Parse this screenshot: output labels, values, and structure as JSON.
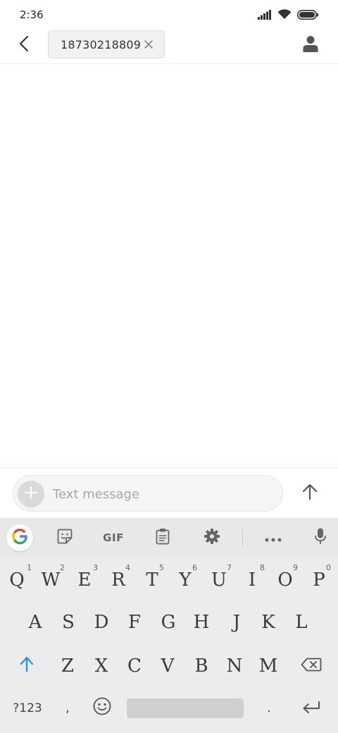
{
  "status_bar": {
    "time": "2:36",
    "icons": [
      "signal-icon",
      "wifi-icon",
      "battery-icon"
    ]
  },
  "header": {
    "back_icon": "chevron-left-icon",
    "recipient": "18730218809",
    "chip_close_icon": "close-icon",
    "contact_icon": "person-icon"
  },
  "compose": {
    "attach_icon": "plus-icon",
    "placeholder": "Text message",
    "value": "",
    "send_icon": "arrow-up-icon"
  },
  "keyboard": {
    "toolbar": {
      "items": [
        "google-icon",
        "sticker-icon",
        "gif",
        "clipboard-icon",
        "gear-icon",
        "more-icon",
        "microphone-icon"
      ],
      "gif_label": "GIF"
    },
    "row1": [
      {
        "key": "Q",
        "hint": "1"
      },
      {
        "key": "W",
        "hint": "2"
      },
      {
        "key": "E",
        "hint": "3"
      },
      {
        "key": "R",
        "hint": "4"
      },
      {
        "key": "T",
        "hint": "5"
      },
      {
        "key": "Y",
        "hint": "6"
      },
      {
        "key": "U",
        "hint": "7"
      },
      {
        "key": "I",
        "hint": "8"
      },
      {
        "key": "O",
        "hint": "9"
      },
      {
        "key": "P",
        "hint": "0"
      }
    ],
    "row2": [
      "A",
      "S",
      "D",
      "F",
      "G",
      "H",
      "J",
      "K",
      "L"
    ],
    "row3": [
      "Z",
      "X",
      "C",
      "V",
      "B",
      "N",
      "M"
    ],
    "row4": {
      "symbols": "?123",
      "comma": ",",
      "period": ".",
      "emoji_icon": "emoji-icon",
      "enter_icon": "enter-icon"
    },
    "shift_icon": "shift-icon",
    "backspace_icon": "backspace-icon",
    "accent_color": "#2196f3"
  }
}
